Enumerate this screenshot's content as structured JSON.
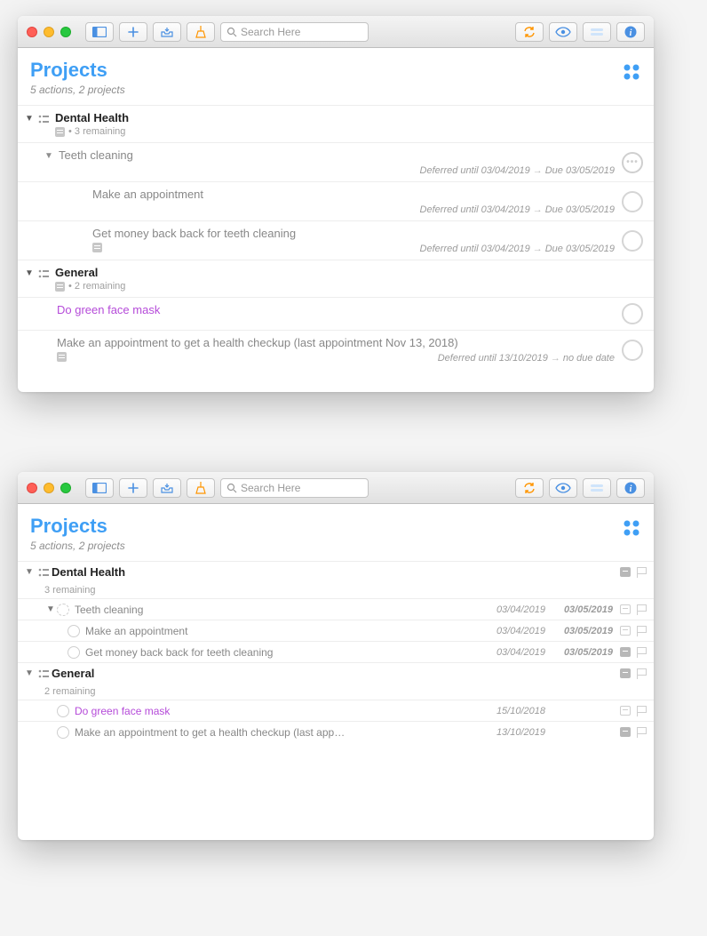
{
  "toolbar": {
    "search_placeholder": "Search Here"
  },
  "header": {
    "title": "Projects",
    "subtitle": "5 actions, 2 projects"
  },
  "window1": {
    "projects": [
      {
        "name": "Dental Health",
        "remaining": "• 3 remaining",
        "groups": [
          {
            "title": "Teeth cleaning",
            "defer": "Deferred until 03/04/2019",
            "due": "Due 03/05/2019",
            "tasks": [
              {
                "title": "Make an appointment",
                "defer": "Deferred until 03/04/2019",
                "due": "Due 03/05/2019"
              },
              {
                "title": "Get money back back for teeth cleaning",
                "defer": "Deferred until 03/04/2019",
                "due": "Due 03/05/2019",
                "note": true
              }
            ]
          }
        ]
      },
      {
        "name": "General",
        "remaining": "• 2 remaining",
        "tasks": [
          {
            "title": "Do green face mask",
            "purple": true
          },
          {
            "title": "Make an appointment to get a health checkup (last appointment Nov 13, 2018)",
            "defer": "Deferred until 13/10/2019",
            "due": "no due date",
            "note": true
          }
        ]
      }
    ]
  },
  "window2": {
    "projects": [
      {
        "name": "Dental Health",
        "remaining": "3 remaining",
        "rows": [
          {
            "kind": "group",
            "title": "Teeth cleaning",
            "d1": "03/04/2019",
            "d2": "03/05/2019"
          },
          {
            "kind": "task",
            "title": "Make an appointment",
            "d1": "03/04/2019",
            "d2": "03/05/2019"
          },
          {
            "kind": "task",
            "title": "Get money back back for teeth cleaning",
            "d1": "03/04/2019",
            "d2": "03/05/2019",
            "note": true
          }
        ]
      },
      {
        "name": "General",
        "remaining": "2 remaining",
        "rows": [
          {
            "kind": "task",
            "title": "Do green face mask",
            "d1": "15/10/2018",
            "d2": "",
            "purple": true
          },
          {
            "kind": "task",
            "title": "Make an appointment to get a health checkup (last app…",
            "d1": "13/10/2019",
            "d2": "",
            "note": true
          }
        ]
      }
    ]
  }
}
